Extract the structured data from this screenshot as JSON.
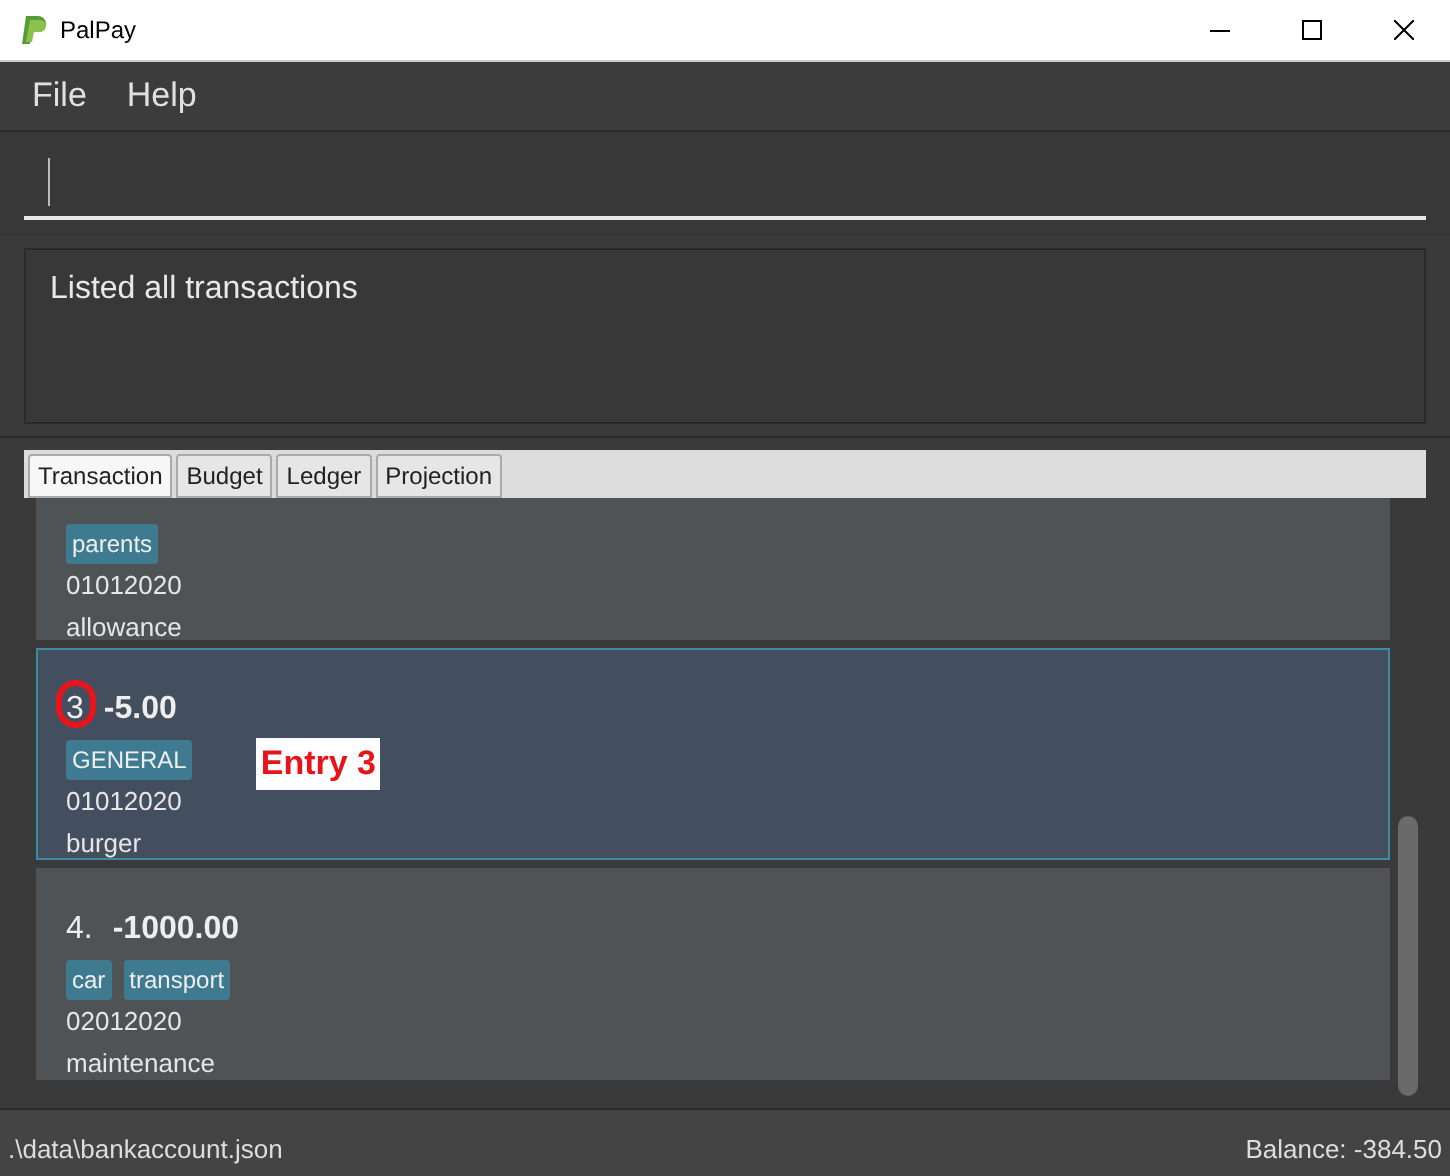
{
  "window": {
    "title": "PalPay"
  },
  "menu": [
    "File",
    "Help"
  ],
  "result": "Listed all transactions",
  "tabs": [
    {
      "label": "Transaction",
      "selected": true
    },
    {
      "label": "Budget",
      "selected": false
    },
    {
      "label": "Ledger",
      "selected": false
    },
    {
      "label": "Projection",
      "selected": false
    }
  ],
  "transactions": [
    {
      "tags": [
        "parents"
      ],
      "date": "01012020",
      "description": "allowance",
      "selected": false
    },
    {
      "index": "3",
      "amount": "-5.00",
      "tags": [
        "GENERAL"
      ],
      "date": "01012020",
      "description": "burger",
      "selected": true,
      "annotation": "Entry 3"
    },
    {
      "index": "4.",
      "amount": "-1000.00",
      "tags": [
        "car",
        "transport"
      ],
      "date": "02012020",
      "description": "maintenance",
      "selected": false
    }
  ],
  "status_bar": {
    "path": ".\\data\\bankaccount.json",
    "balance": "Balance: -384.50"
  }
}
